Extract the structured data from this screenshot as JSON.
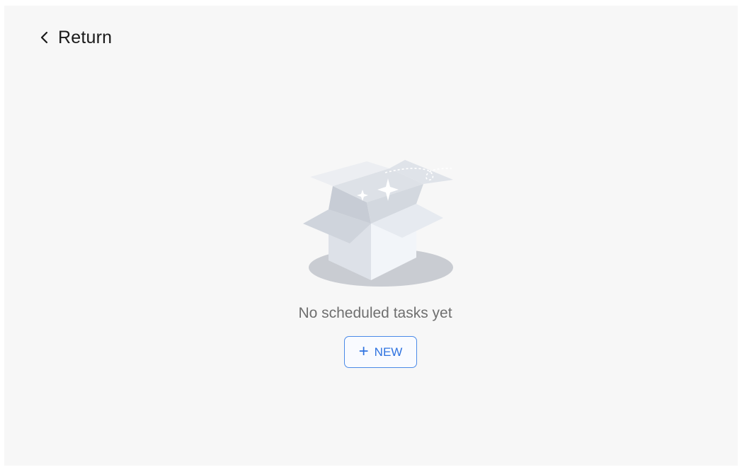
{
  "nav": {
    "return_label": "Return",
    "return_icon": "chevron-left-icon"
  },
  "empty_state": {
    "illustration_icon": "open-box-icon",
    "message": "No scheduled tasks yet",
    "new_button": {
      "icon": "plus-icon",
      "plus_glyph": "+",
      "label": "NEW"
    }
  },
  "colors": {
    "background": "#f7f7f7",
    "accent": "#2f73e0",
    "message_text": "#6f6f6f"
  }
}
